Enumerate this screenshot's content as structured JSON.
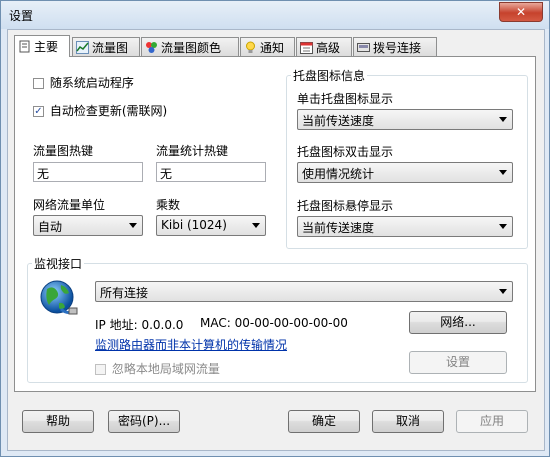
{
  "window": {
    "title": "设置",
    "close_glyph": "✕"
  },
  "tabs": [
    {
      "label": "主要",
      "icon": "page-icon"
    },
    {
      "label": "流量图",
      "icon": "chart-icon"
    },
    {
      "label": "流量图颜色",
      "icon": "palette-icon"
    },
    {
      "label": "通知",
      "icon": "bulb-icon"
    },
    {
      "label": "高级",
      "icon": "calendar-icon"
    },
    {
      "label": "拨号连接",
      "icon": "dialup-icon"
    }
  ],
  "main": {
    "autostart_label": "随系统启动程序",
    "autostart_checked": false,
    "autoupdate_label": "自动检查更新(需联网)",
    "autoupdate_checked": true,
    "graph_hotkey_label": "流量图热键",
    "graph_hotkey_value": "无",
    "stats_hotkey_label": "流量统计热键",
    "stats_hotkey_value": "无",
    "unit_label": "网络流量单位",
    "unit_value": "自动",
    "multiplier_label": "乘数",
    "multiplier_value": "Kibi (1024)"
  },
  "tray": {
    "title": "托盘图标信息",
    "click_label": "单击托盘图标显示",
    "click_value": "当前传送速度",
    "dblclick_label": "托盘图标双击显示",
    "dblclick_value": "使用情况统计",
    "hover_label": "托盘图标悬停显示",
    "hover_value": "当前传送速度"
  },
  "monitor": {
    "title": "监视接口",
    "interface_value": "所有连接",
    "ip_text": "IP 地址:  0.0.0.0",
    "mac_text": "MAC: 00-00-00-00-00-00",
    "router_link": "监测路由器而非本计算机的传输情况",
    "ignore_lan_label": "忽略本地局域网流量",
    "network_button": "网络...",
    "settings_button": "设置"
  },
  "footer": {
    "help": "帮助",
    "password": "密码(P)...",
    "ok": "确定",
    "cancel": "取消",
    "apply": "应用"
  },
  "colors": {
    "accent": "#2a4fa0",
    "link": "#0033aa",
    "close": "#c6422d"
  }
}
